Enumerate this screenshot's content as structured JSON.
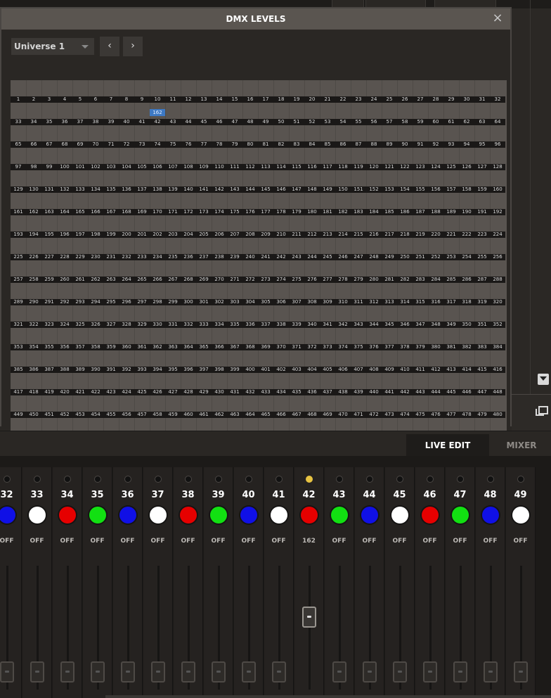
{
  "dialog": {
    "title": "DMX LEVELS",
    "close_label": "×"
  },
  "universe": {
    "selected": "Universe 1",
    "prev_label": "‹",
    "next_label": "›"
  },
  "dmx_grid": {
    "columns": 32,
    "rows": 16,
    "channel_count": 512,
    "active": [
      {
        "channel": 42,
        "value": 162
      }
    ]
  },
  "tabs": {
    "live_edit": "LIVE EDIT",
    "mixer": "MIXER"
  },
  "mixer": {
    "channels": [
      {
        "num": "32",
        "color": "#1010e6",
        "level": "OFF",
        "led_on": false,
        "fader": 0
      },
      {
        "num": "33",
        "color": "#ffffff",
        "level": "OFF",
        "led_on": false,
        "fader": 0
      },
      {
        "num": "34",
        "color": "#e60000",
        "level": "OFF",
        "led_on": false,
        "fader": 0
      },
      {
        "num": "35",
        "color": "#12e012",
        "level": "OFF",
        "led_on": false,
        "fader": 0
      },
      {
        "num": "36",
        "color": "#1010e6",
        "level": "OFF",
        "led_on": false,
        "fader": 0
      },
      {
        "num": "37",
        "color": "#ffffff",
        "level": "OFF",
        "led_on": false,
        "fader": 0
      },
      {
        "num": "38",
        "color": "#e60000",
        "level": "OFF",
        "led_on": false,
        "fader": 0
      },
      {
        "num": "39",
        "color": "#12e012",
        "level": "OFF",
        "led_on": false,
        "fader": 0
      },
      {
        "num": "40",
        "color": "#1010e6",
        "level": "OFF",
        "led_on": false,
        "fader": 0
      },
      {
        "num": "41",
        "color": "#ffffff",
        "level": "OFF",
        "led_on": false,
        "fader": 0
      },
      {
        "num": "42",
        "color": "#e60000",
        "level": "162",
        "led_on": true,
        "fader": 0.64
      },
      {
        "num": "43",
        "color": "#12e012",
        "level": "OFF",
        "led_on": false,
        "fader": 0
      },
      {
        "num": "44",
        "color": "#1010e6",
        "level": "OFF",
        "led_on": false,
        "fader": 0
      },
      {
        "num": "45",
        "color": "#ffffff",
        "level": "OFF",
        "led_on": false,
        "fader": 0
      },
      {
        "num": "46",
        "color": "#e60000",
        "level": "OFF",
        "led_on": false,
        "fader": 0
      },
      {
        "num": "47",
        "color": "#12e012",
        "level": "OFF",
        "led_on": false,
        "fader": 0
      },
      {
        "num": "48",
        "color": "#1010e6",
        "level": "OFF",
        "led_on": false,
        "fader": 0
      },
      {
        "num": "49",
        "color": "#ffffff",
        "level": "OFF",
        "led_on": false,
        "fader": 0
      }
    ]
  }
}
